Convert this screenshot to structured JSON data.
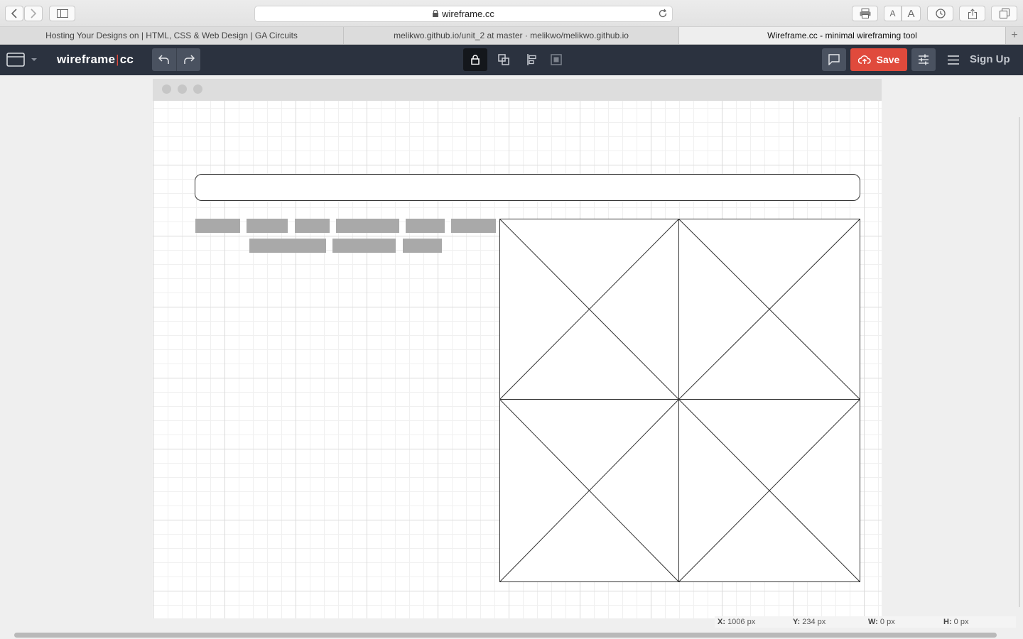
{
  "browser": {
    "url": "wireframe.cc",
    "tabs": [
      {
        "label": "Hosting Your Designs on | HTML, CSS & Web Design | GA Circuits",
        "active": false
      },
      {
        "label": "melikwo.github.io/unit_2 at master · melikwo/melikwo.github.io",
        "active": false
      },
      {
        "label": "Wireframe.cc - minimal wireframing tool",
        "active": true
      }
    ],
    "font_small": "A",
    "font_large": "A"
  },
  "app": {
    "logo_left": "wireframe",
    "logo_sep": "|",
    "logo_right": "cc",
    "save_label": "Save",
    "signup_label": "Sign Up",
    "accent_color": "#e04a3c",
    "header_color": "#2b323f"
  },
  "canvas": {
    "nav_rows": [
      {
        "count": 6
      },
      {
        "count": 3
      }
    ]
  },
  "status": {
    "x_label": "X:",
    "x_value": "1006 px",
    "y_label": "Y:",
    "y_value": "234 px",
    "w_label": "W:",
    "w_value": "0 px",
    "h_label": "H:",
    "h_value": "0 px"
  }
}
